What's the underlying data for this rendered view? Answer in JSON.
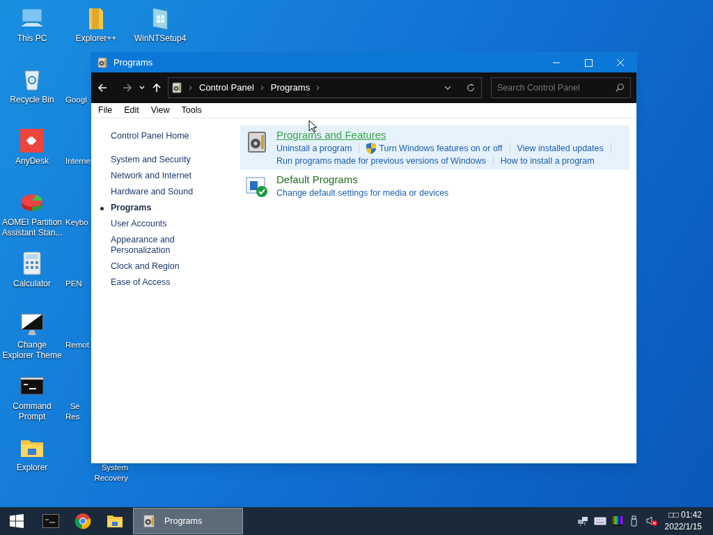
{
  "desktop": {
    "columns": [
      {
        "kind": "full",
        "items": [
          {
            "kind": "pc",
            "label": "This PC"
          },
          {
            "kind": "recycle",
            "label": "Recycle Bin"
          },
          {
            "kind": "anydesk",
            "label": "AnyDesk"
          },
          {
            "kind": "aomei",
            "label": "AOMEI Partition Assistant Stan..."
          },
          {
            "kind": "calculator",
            "label": "Calculator"
          },
          {
            "kind": "theme",
            "label": "Change Explorer Theme"
          },
          {
            "kind": "cmd",
            "label": "Command Prompt"
          },
          {
            "kind": "explorer",
            "label": "Explorer"
          }
        ]
      },
      {
        "kind": "partial",
        "items": [
          {
            "kind": "folder",
            "label": "Explorer++"
          },
          {
            "kind": "none",
            "label": "Googl"
          },
          {
            "kind": "none",
            "label": "Interne"
          },
          {
            "kind": "none",
            "label": "Keybo"
          },
          {
            "kind": "none",
            "label": "PEN"
          },
          {
            "kind": "none",
            "label": "Remot"
          },
          {
            "kind": "none",
            "label": "Se\nRes"
          },
          {
            "kind": "none",
            "label": "System Recovery"
          }
        ]
      },
      {
        "kind": "full",
        "items": [
          {
            "kind": "setup",
            "label": "WinNTSetup4"
          }
        ]
      }
    ]
  },
  "window": {
    "title": "Programs",
    "address": {
      "crumbs": [
        "Control Panel",
        "Programs"
      ]
    },
    "search": {
      "placeholder": "Search Control Panel"
    },
    "menu": [
      "File",
      "Edit",
      "View",
      "Tools"
    ],
    "sidebar": {
      "home": "Control Panel Home",
      "items": [
        {
          "label": "System and Security",
          "selected": false
        },
        {
          "label": "Network and Internet",
          "selected": false
        },
        {
          "label": "Hardware and Sound",
          "selected": false
        },
        {
          "label": "Programs",
          "selected": true
        },
        {
          "label": "User Accounts",
          "selected": false
        },
        {
          "label": "Appearance and Personalization",
          "selected": false
        },
        {
          "label": "Clock and Region",
          "selected": false
        },
        {
          "label": "Ease of Access",
          "selected": false
        }
      ]
    },
    "categories": [
      {
        "kind": "programs",
        "title": "Programs and Features",
        "highlighted": true,
        "link_rows": [
          [
            {
              "label": "Uninstall a program",
              "shield": false
            },
            {
              "label": "Turn Windows features on or off",
              "shield": true
            },
            {
              "label": "View installed updates",
              "shield": false
            }
          ],
          [
            {
              "label": "Run programs made for previous versions of Windows",
              "shield": false
            },
            {
              "label": "How to install a program",
              "shield": false
            }
          ]
        ]
      },
      {
        "kind": "defaults",
        "title": "Default Programs",
        "highlighted": false,
        "link_rows": [
          [
            {
              "label": "Change default settings for media or devices",
              "shield": false
            }
          ]
        ]
      }
    ]
  },
  "taskbar": {
    "pinned": [
      {
        "kind": "cmd"
      },
      {
        "kind": "chrome"
      },
      {
        "kind": "explorer"
      }
    ],
    "tasks": [
      {
        "label": "Programs",
        "selected": true
      }
    ],
    "tray": [
      {
        "kind": "network"
      },
      {
        "kind": "keyboard"
      },
      {
        "kind": "display"
      },
      {
        "kind": "usb"
      },
      {
        "kind": "volume-muted"
      }
    ],
    "time": "□□ 01:42",
    "date": "2022/1/15"
  }
}
